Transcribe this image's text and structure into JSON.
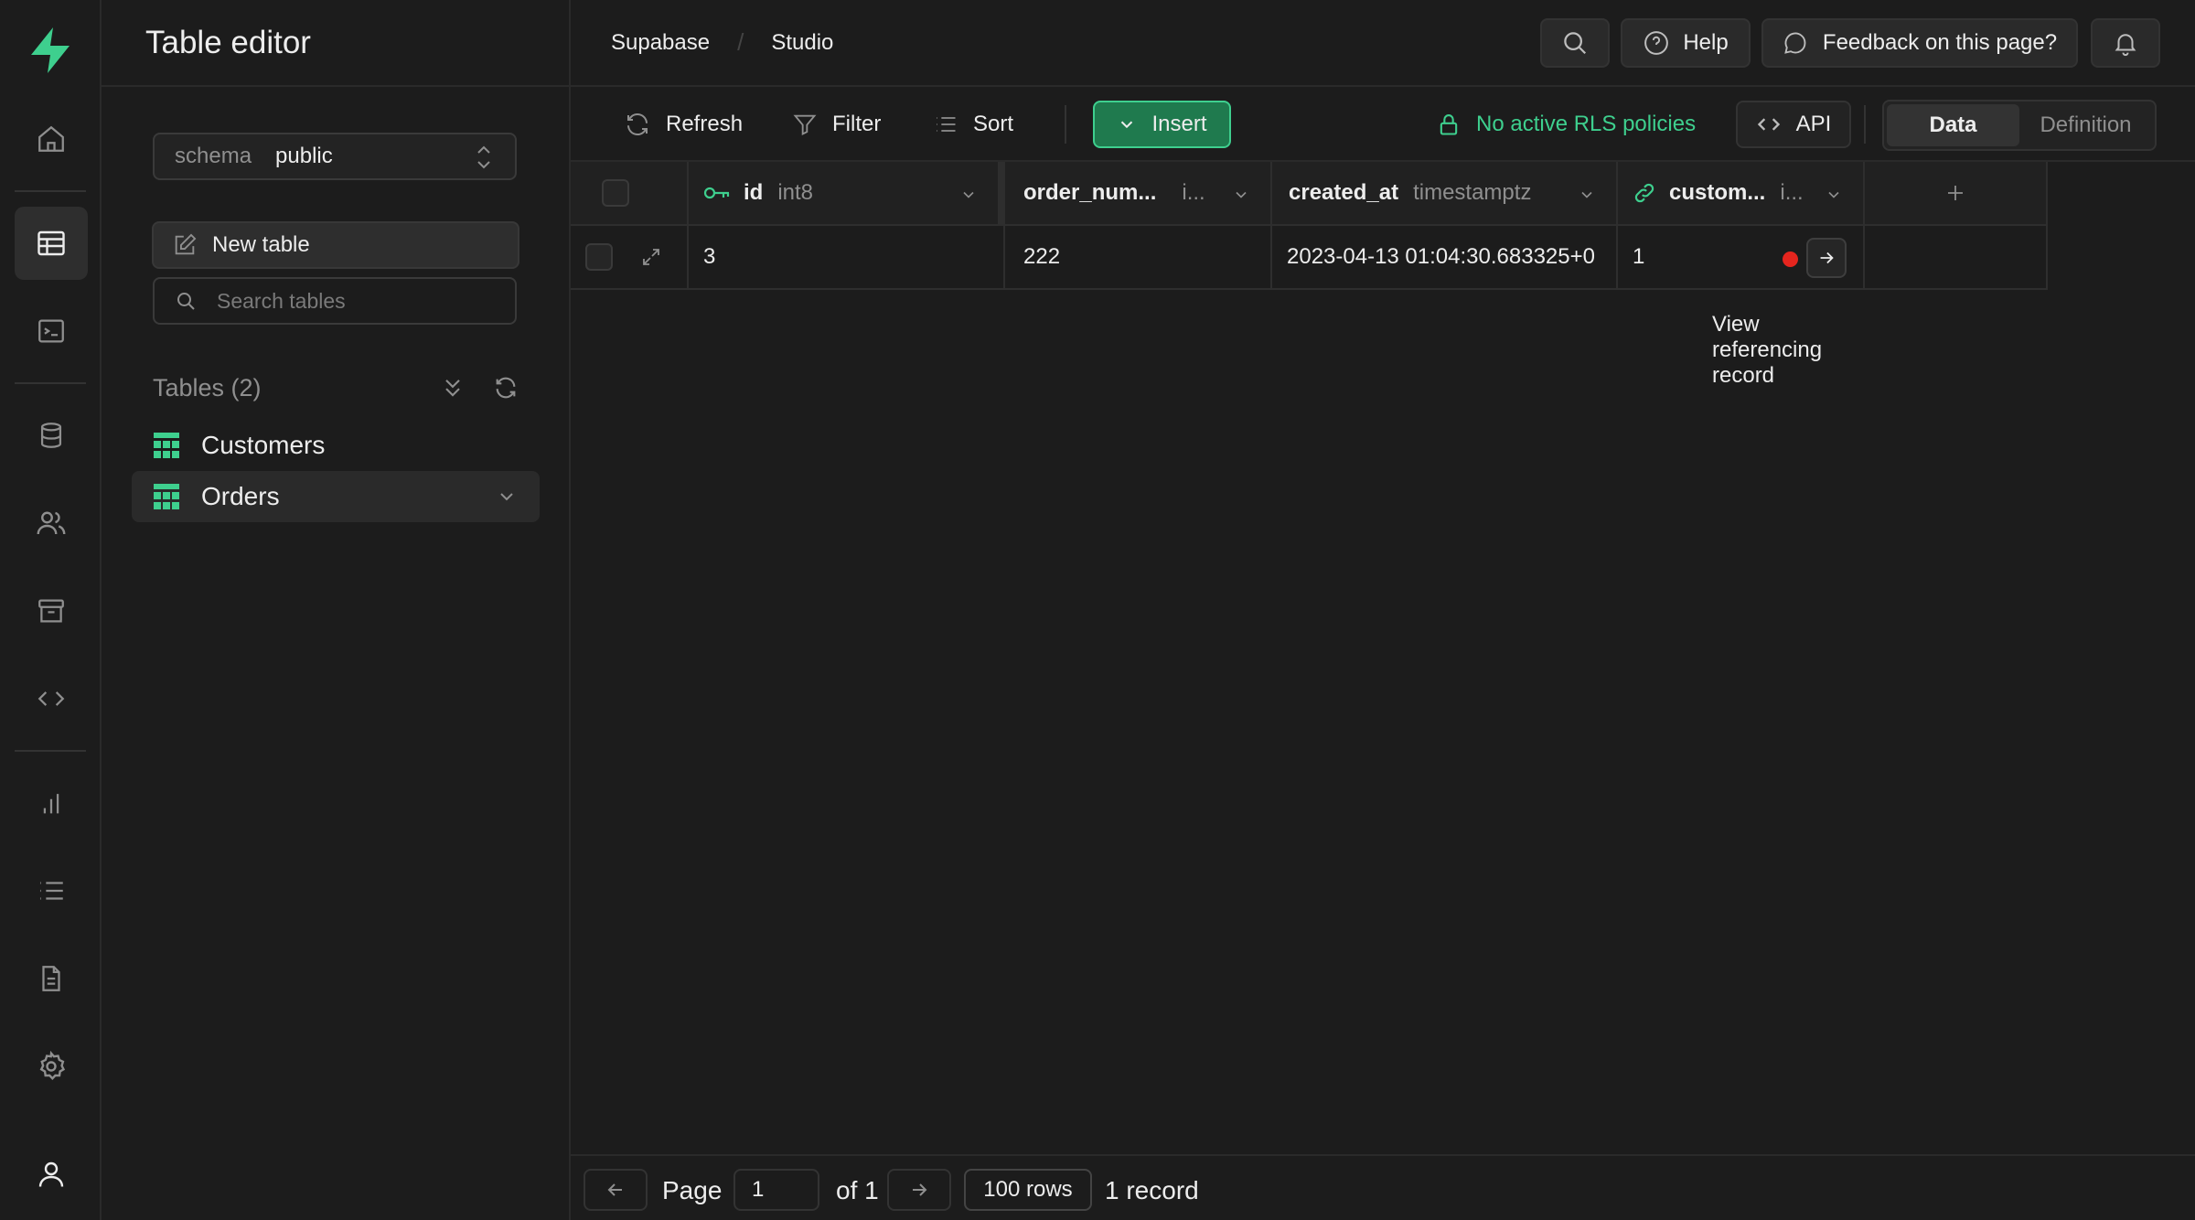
{
  "sidebar": {
    "title": "Table editor",
    "schema": {
      "label": "schema",
      "value": "public"
    },
    "new_table_label": "New table",
    "search_placeholder": "Search tables",
    "tables_heading": "Tables (2)",
    "tables": [
      {
        "name": "Customers",
        "active": false
      },
      {
        "name": "Orders",
        "active": true
      }
    ]
  },
  "rail": {
    "items": [
      "home-icon",
      "table-editor-icon",
      "sql-editor-icon",
      "database-icon",
      "auth-users-icon",
      "storage-icon",
      "edge-functions-icon",
      "reports-icon",
      "logs-icon",
      "api-docs-icon",
      "settings-icon",
      "account-icon"
    ],
    "active": "table-editor-icon"
  },
  "breadcrumb": {
    "org": "Supabase",
    "project": "Studio"
  },
  "topbar": {
    "help_label": "Help",
    "feedback_label": "Feedback on this page?"
  },
  "toolbar": {
    "refresh_label": "Refresh",
    "filter_label": "Filter",
    "sort_label": "Sort",
    "insert_label": "Insert",
    "rls_label": "No active RLS policies",
    "api_label": "API",
    "view_tabs": {
      "data": "Data",
      "definition": "Definition",
      "active": "Data"
    }
  },
  "grid": {
    "columns": [
      {
        "name": "id",
        "type": "int8",
        "primary_key": true
      },
      {
        "name": "order_num...",
        "type": "i..."
      },
      {
        "name": "created_at",
        "type": "timestamptz"
      },
      {
        "name": "custom...",
        "type": "i...",
        "foreign_key": true
      }
    ],
    "rows": [
      {
        "id": "3",
        "order_number": "222",
        "created_at": "2023-04-13 01:04:30.683325+0",
        "customer": "1"
      }
    ],
    "fk_tooltip": "View referencing record"
  },
  "footer": {
    "page_label": "Page",
    "page_value": "1",
    "of_label": "of 1",
    "rows_label": "100 rows",
    "record_count": "1 record"
  },
  "colors": {
    "background": "#1c1c1c",
    "brand_green": "#3ecf8e",
    "insert_button": "#1f7a4e",
    "fk_indicator": "#e5251e"
  }
}
